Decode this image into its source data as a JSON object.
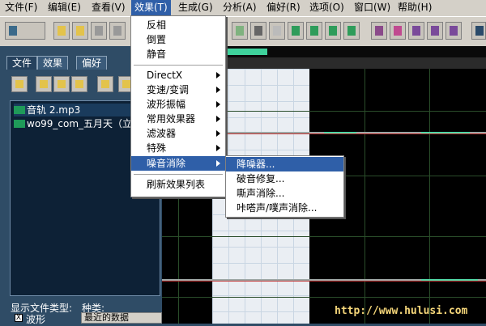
{
  "menubar": {
    "items": [
      {
        "label": "文件(F)"
      },
      {
        "label": "编辑(E)"
      },
      {
        "label": "查看(V)"
      },
      {
        "label": "效果(T)"
      },
      {
        "label": "生成(G)"
      },
      {
        "label": "分析(A)"
      },
      {
        "label": "偏好(R)"
      },
      {
        "label": "选项(O)"
      },
      {
        "label": "窗口(W)"
      },
      {
        "label": "帮助(H)"
      }
    ],
    "active_index": 3
  },
  "effects_menu": {
    "items": [
      {
        "label": "反相"
      },
      {
        "label": "倒置"
      },
      {
        "label": "静音"
      },
      {
        "label": "DirectX"
      },
      {
        "label": "变速/变调"
      },
      {
        "label": "波形振幅"
      },
      {
        "label": "常用效果器"
      },
      {
        "label": "滤波器"
      },
      {
        "label": "特殊"
      },
      {
        "label": "噪音消除"
      },
      {
        "label": "刷新效果列表"
      }
    ]
  },
  "noise_submenu": {
    "items": [
      {
        "label": "降噪器..."
      },
      {
        "label": "破音修复..."
      },
      {
        "label": "嘶声消除..."
      },
      {
        "label": "咔嗒声/噗声消除..."
      }
    ]
  },
  "left_panel": {
    "tabs": [
      {
        "label": "文件"
      },
      {
        "label": "效果"
      },
      {
        "label": "偏好"
      }
    ],
    "files": [
      {
        "name": "音轨  2.mp3"
      },
      {
        "name": "wo99_com_五月天（立..."
      }
    ],
    "filter_label": "显示文件类型:",
    "kind_label": "种类:",
    "waveform_checkbox": "波形",
    "checkbox_mark": "X",
    "sort_value": "最近的数据"
  },
  "watermark": "http://www.hulusi.com",
  "colors": {
    "menu_highlight": "#2f5fa8",
    "panel_bg": "#2f4c66",
    "wave_bg": "#000000",
    "wave_green": "#4fd8a6"
  },
  "icons": [
    "folder-icon",
    "save-icon",
    "cut-icon",
    "copy-icon",
    "paste-icon",
    "mix-icon"
  ]
}
